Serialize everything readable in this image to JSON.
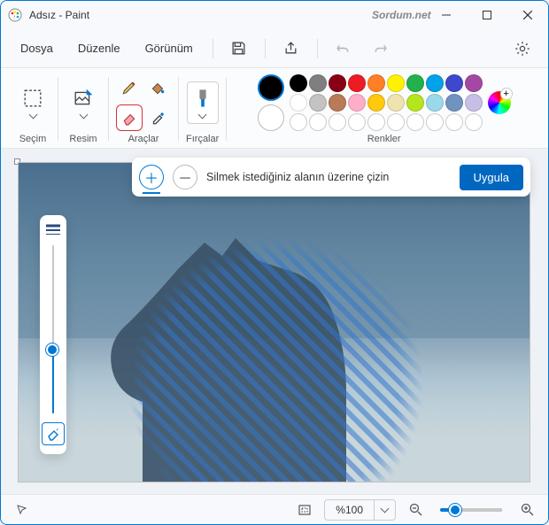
{
  "titlebar": {
    "title": "Adsız - Paint",
    "watermark": "Sordum.net"
  },
  "menu": {
    "file": "Dosya",
    "edit": "Düzenle",
    "view": "Görünüm"
  },
  "ribbon": {
    "selection_label": "Seçim",
    "image_label": "Resim",
    "tools_label": "Araçlar",
    "brushes_label": "Fırçalar",
    "colors_label": "Renkler"
  },
  "palette_row1": [
    "#000000",
    "#7f7f7f",
    "#880015",
    "#ed1c24",
    "#ff7f27",
    "#fff200",
    "#22b14c",
    "#00a2e8",
    "#3f48cc",
    "#a349a4"
  ],
  "palette_row2": [
    "#ffffff",
    "#c3c3c3",
    "#b97a57",
    "#ffaec9",
    "#ffc90e",
    "#efe4b0",
    "#b5e61d",
    "#99d9ea",
    "#7092be",
    "#c8bfe7"
  ],
  "eraser_toolbar": {
    "hint": "Silmek istediğiniz alanın üzerine çizin",
    "apply": "Uygula"
  },
  "statusbar": {
    "zoom": "%100"
  }
}
